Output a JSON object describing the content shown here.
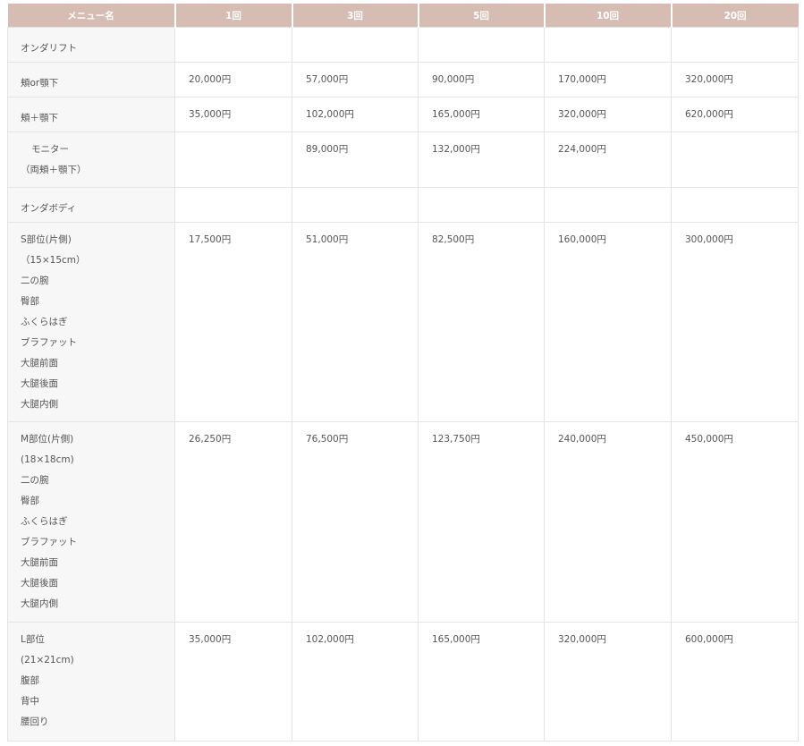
{
  "headers": [
    "メニュー名",
    "1回",
    "3回",
    "5回",
    "10回",
    "20回"
  ],
  "rows": [
    {
      "name_lines": [
        "オンダリフト"
      ],
      "prices": [
        "",
        "",
        "",
        "",
        ""
      ]
    },
    {
      "name_lines": [
        "頬or顎下"
      ],
      "prices": [
        "20,000円",
        "57,000円",
        "90,000円",
        "170,000円",
        "320,000円"
      ]
    },
    {
      "name_lines": [
        "頬＋顎下"
      ],
      "prices": [
        "35,000円",
        "102,000円",
        "165,000円",
        "320,000円",
        "620,000円"
      ]
    },
    {
      "name_lines": [
        "モニター",
        "（両頬＋顎下）"
      ],
      "prices": [
        "",
        "89,000円",
        "132,000円",
        "224,000円",
        ""
      ]
    },
    {
      "name_lines": [
        "オンダボディ"
      ],
      "prices": [
        "",
        "",
        "",
        "",
        ""
      ]
    },
    {
      "name_lines": [
        "S部位(片側)",
        "（15×15cm）",
        "二の腕",
        "臀部",
        "ふくらはぎ",
        "ブラファット",
        "大腿前面",
        "大腿後面",
        "大腿内側"
      ],
      "prices": [
        "17,500円",
        "51,000円",
        "82,500円",
        "160,000円",
        "300,000円"
      ]
    },
    {
      "name_lines": [
        "M部位(片側)",
        "(18×18cm)",
        "二の腕",
        "臀部",
        "ふくらはぎ",
        "ブラファット",
        "大腿前面",
        "大腿後面",
        "大腿内側"
      ],
      "prices": [
        "26,250円",
        "76,500円",
        "123,750円",
        "240,000円",
        "450,000円"
      ]
    },
    {
      "name_lines": [
        "L部位",
        "(21×21cm)",
        "腹部",
        "背中",
        "腰回り"
      ],
      "prices": [
        "35,000円",
        "102,000円",
        "165,000円",
        "320,000円",
        "600,000円"
      ]
    }
  ]
}
